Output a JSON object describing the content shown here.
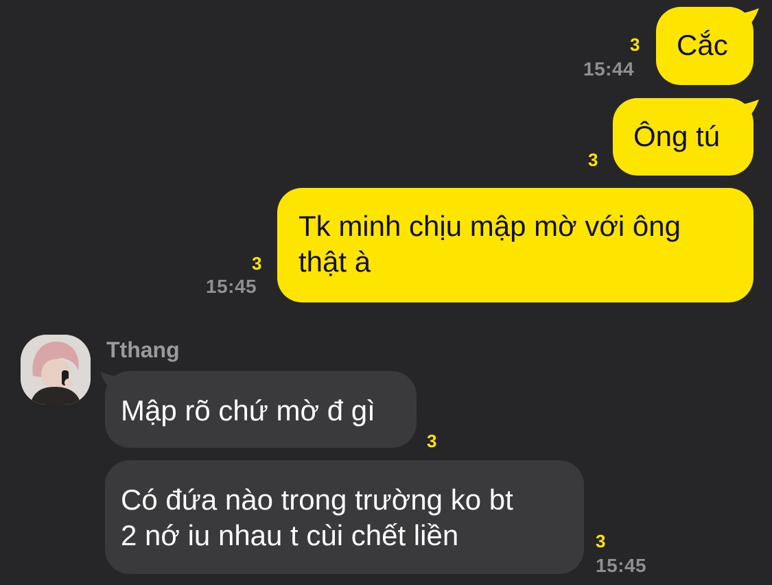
{
  "messages": [
    {
      "id": "m1",
      "direction": "outgoing",
      "text": "Cắc",
      "unread": "3",
      "time": "15:44"
    },
    {
      "id": "m2",
      "direction": "outgoing",
      "text": "Ông tú",
      "unread": "3",
      "time": ""
    },
    {
      "id": "m3",
      "direction": "outgoing",
      "lines": [
        "Tk minh chịu mập mờ với ông",
        "thật à"
      ],
      "unread": "3",
      "time": "15:45"
    },
    {
      "id": "m4",
      "direction": "incoming",
      "sender": "Tthang",
      "text": "Mập rõ chứ mờ đ gì",
      "unread": "3",
      "time": ""
    },
    {
      "id": "m5",
      "direction": "incoming",
      "lines": [
        "Có đứa nào trong trường ko bt",
        "2 nớ iu nhau t cùi chết liền"
      ],
      "unread": "3",
      "time": "15:45"
    }
  ],
  "colors": {
    "background": "#262628",
    "outgoing_bubble": "#FEE500",
    "incoming_bubble": "#3A3A3C",
    "unread_count": "#FEE500",
    "timestamp": "#8E8E93"
  },
  "icons": {
    "avatar": "profile-photo-avatar"
  }
}
